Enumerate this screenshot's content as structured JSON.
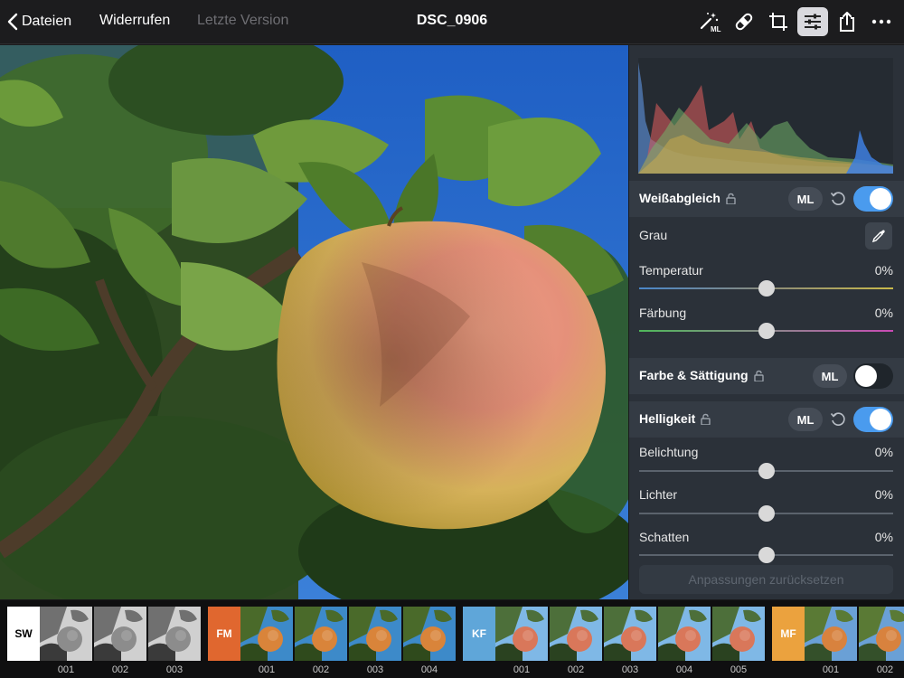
{
  "topbar": {
    "back_label": "Dateien",
    "undo_label": "Widerrufen",
    "last_version_label": "Letzte Version",
    "title": "DSC_0906",
    "ml_badge": "ML",
    "icons": [
      "magic-wand-ml-icon",
      "bandage-heal-icon",
      "crop-icon",
      "sliders-icon",
      "share-icon",
      "more-icon"
    ],
    "active_icon": "sliders-icon"
  },
  "panel": {
    "white_balance": {
      "title": "Weißabgleich",
      "ml_label": "ML",
      "enabled": true,
      "grey_label": "Grau",
      "temperature": {
        "label": "Temperatur",
        "value": "0%",
        "level": 0.5
      },
      "tint": {
        "label": "Färbung",
        "value": "0%",
        "level": 0.5
      }
    },
    "color_saturation": {
      "title": "Farbe & Sättigung",
      "ml_label": "ML",
      "enabled": false
    },
    "brightness": {
      "title": "Helligkeit",
      "ml_label": "ML",
      "enabled": true,
      "exposure": {
        "label": "Belichtung",
        "value": "0%",
        "level": 0.5
      },
      "highlights": {
        "label": "Lichter",
        "value": "0%",
        "level": 0.5
      },
      "shadows": {
        "label": "Schatten",
        "value": "0%",
        "level": 0.5
      }
    },
    "reset_all_label": "Anpassungen zurücksetzen"
  },
  "filmstrip": {
    "groups": [
      {
        "tag": "SW",
        "tag_color": "#ffffff",
        "tag_text_color": "#000000",
        "style": "bw",
        "items": [
          "001",
          "002",
          "003"
        ]
      },
      {
        "tag": "FM",
        "tag_color": "#e0672f",
        "tag_text_color": "#ffffff",
        "style": "warm",
        "items": [
          "001",
          "002",
          "003",
          "004"
        ]
      },
      {
        "tag": "KF",
        "tag_color": "#5fa6d9",
        "tag_text_color": "#ffffff",
        "style": "cool",
        "items": [
          "001",
          "002",
          "003",
          "004",
          "005"
        ]
      },
      {
        "tag": "MF",
        "tag_color": "#eba23e",
        "tag_text_color": "#ffffff",
        "style": "mild",
        "items": [
          "001",
          "002"
        ]
      }
    ]
  },
  "colors": {
    "accent": "#4a9bee",
    "panel_bg": "#2b3139",
    "section_bg": "#343b44",
    "sky": "#2a6fd1"
  }
}
